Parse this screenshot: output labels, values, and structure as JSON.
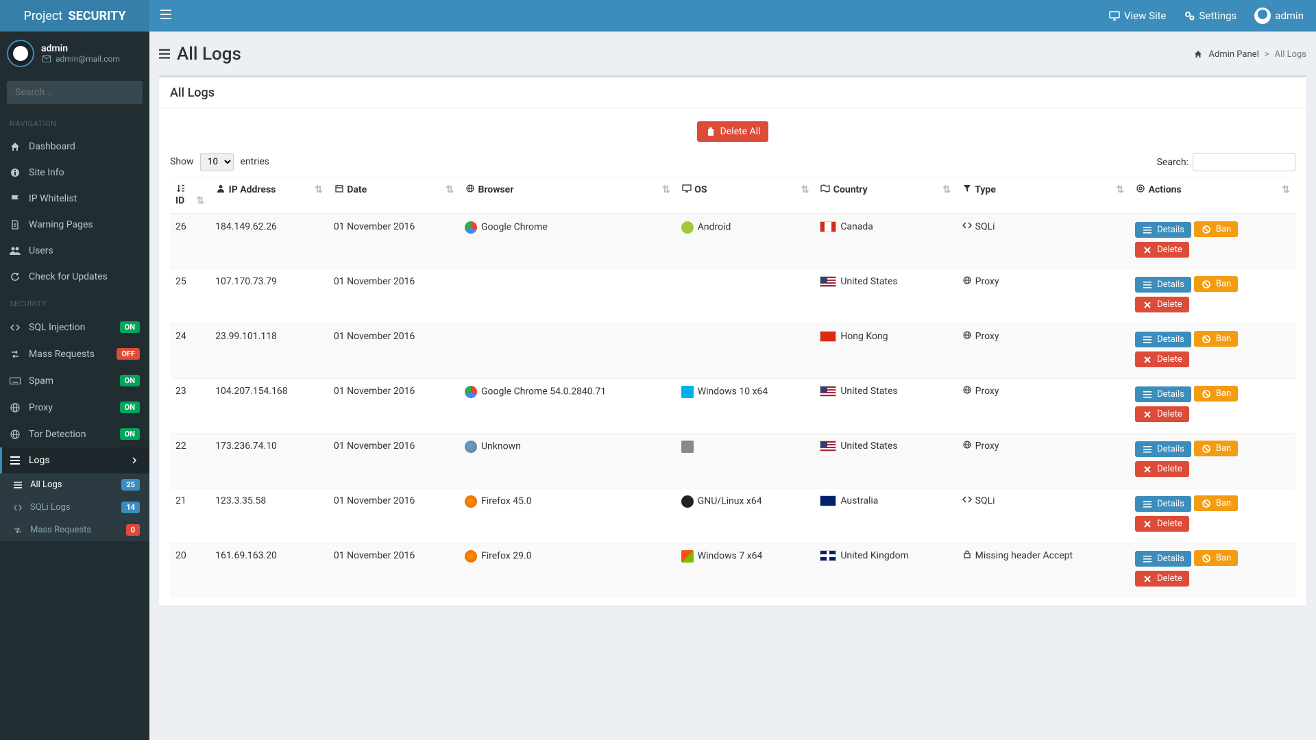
{
  "brand": {
    "pre": "Project",
    "bold": "SECURITY"
  },
  "topbar": {
    "view_site": "View Site",
    "settings": "Settings",
    "user": "admin"
  },
  "sidebar": {
    "user": {
      "name": "admin",
      "email": "admin@mail.com"
    },
    "search_placeholder": "Search...",
    "navigation_label": "NAVIGATION",
    "security_label": "SECURITY",
    "nav": {
      "dashboard": "Dashboard",
      "siteinfo": "Site Info",
      "ipwhitelist": "IP Whitelist",
      "warningpages": "Warning Pages",
      "users": "Users",
      "updates": "Check for Updates"
    },
    "sec": {
      "sql": {
        "label": "SQL Injection",
        "badge": "ON"
      },
      "mass": {
        "label": "Mass Requests",
        "badge": "OFF"
      },
      "spam": {
        "label": "Spam",
        "badge": "ON"
      },
      "proxy": {
        "label": "Proxy",
        "badge": "ON"
      },
      "tor": {
        "label": "Tor Detection",
        "badge": "ON"
      },
      "logs": {
        "label": "Logs"
      },
      "sub": {
        "all": {
          "label": "All Logs",
          "badge": "25"
        },
        "sqli": {
          "label": "SQLi Logs",
          "badge": "14"
        },
        "massreq": {
          "label": "Mass Requests",
          "badge": "0"
        }
      }
    }
  },
  "page": {
    "title": "All Logs",
    "breadcrumb": {
      "admin": "Admin Panel",
      "current": "All Logs"
    },
    "panel_title": "All Logs",
    "delete_all": "Delete All",
    "show_label_pre": "Show",
    "show_label_post": "entries",
    "show_selected": "10",
    "search_label": "Search:",
    "columns": {
      "id": "ID",
      "ip": "IP Address",
      "date": "Date",
      "browser": "Browser",
      "os": "OS",
      "country": "Country",
      "type": "Type",
      "actions": "Actions"
    },
    "actions": {
      "details": "Details",
      "ban": "Ban",
      "delete": "Delete"
    },
    "rows": [
      {
        "id": "26",
        "ip": "184.149.62.26",
        "date": "01 November 2016",
        "browser": "Google Chrome",
        "browser_class": "chrome",
        "os": "Android",
        "os_class": "android",
        "country": "Canada",
        "flag": "ca",
        "type": "SQLi",
        "type_icon": "code"
      },
      {
        "id": "25",
        "ip": "107.170.73.79",
        "date": "01 November 2016",
        "browser": "",
        "browser_class": "",
        "os": "",
        "os_class": "",
        "country": "United States",
        "flag": "us",
        "type": "Proxy",
        "type_icon": "globe"
      },
      {
        "id": "24",
        "ip": "23.99.101.118",
        "date": "01 November 2016",
        "browser": "",
        "browser_class": "",
        "os": "",
        "os_class": "",
        "country": "Hong Kong",
        "flag": "hk",
        "type": "Proxy",
        "type_icon": "globe"
      },
      {
        "id": "23",
        "ip": "104.207.154.168",
        "date": "01 November 2016",
        "browser": "Google Chrome 54.0.2840.71",
        "browser_class": "chrome",
        "os": "Windows 10 x64",
        "os_class": "win10",
        "country": "United States",
        "flag": "us",
        "type": "Proxy",
        "type_icon": "globe"
      },
      {
        "id": "22",
        "ip": "173.236.74.10",
        "date": "01 November 2016",
        "browser": "Unknown",
        "browser_class": "unknown",
        "os": "",
        "os_class": "none",
        "country": "United States",
        "flag": "us",
        "type": "Proxy",
        "type_icon": "globe"
      },
      {
        "id": "21",
        "ip": "123.3.35.58",
        "date": "01 November 2016",
        "browser": "Firefox 45.0",
        "browser_class": "firefox",
        "os": "GNU/Linux x64",
        "os_class": "linux",
        "country": "Australia",
        "flag": "au",
        "type": "SQLi",
        "type_icon": "code"
      },
      {
        "id": "20",
        "ip": "161.69.163.20",
        "date": "01 November 2016",
        "browser": "Firefox 29.0",
        "browser_class": "firefox",
        "os": "Windows 7 x64",
        "os_class": "win7",
        "country": "United Kingdom",
        "flag": "gb",
        "type": "Missing header Accept",
        "type_icon": "lock"
      }
    ]
  }
}
